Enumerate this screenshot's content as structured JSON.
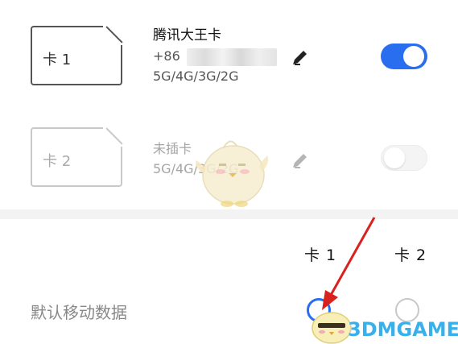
{
  "sim1": {
    "card_label": "卡 1",
    "carrier": "腾讯大王卡",
    "phone_prefix": "+86",
    "network": "5G/4G/3G/2G",
    "enabled": true,
    "edit_icon": "pencil-icon"
  },
  "sim2": {
    "card_label": "卡 2",
    "status": "未插卡",
    "network": "5G/4G/3G/2G",
    "enabled": false,
    "edit_icon": "pencil-icon"
  },
  "default_data": {
    "label": "默认移动数据",
    "col1_header": "卡 1",
    "col2_header": "卡 2",
    "selected": "卡 1"
  },
  "watermark": {
    "text": "3DMGAME"
  },
  "colors": {
    "accent": "#2a6ef0",
    "watermark": "#3ab0ea",
    "arrow": "#d9211e"
  }
}
